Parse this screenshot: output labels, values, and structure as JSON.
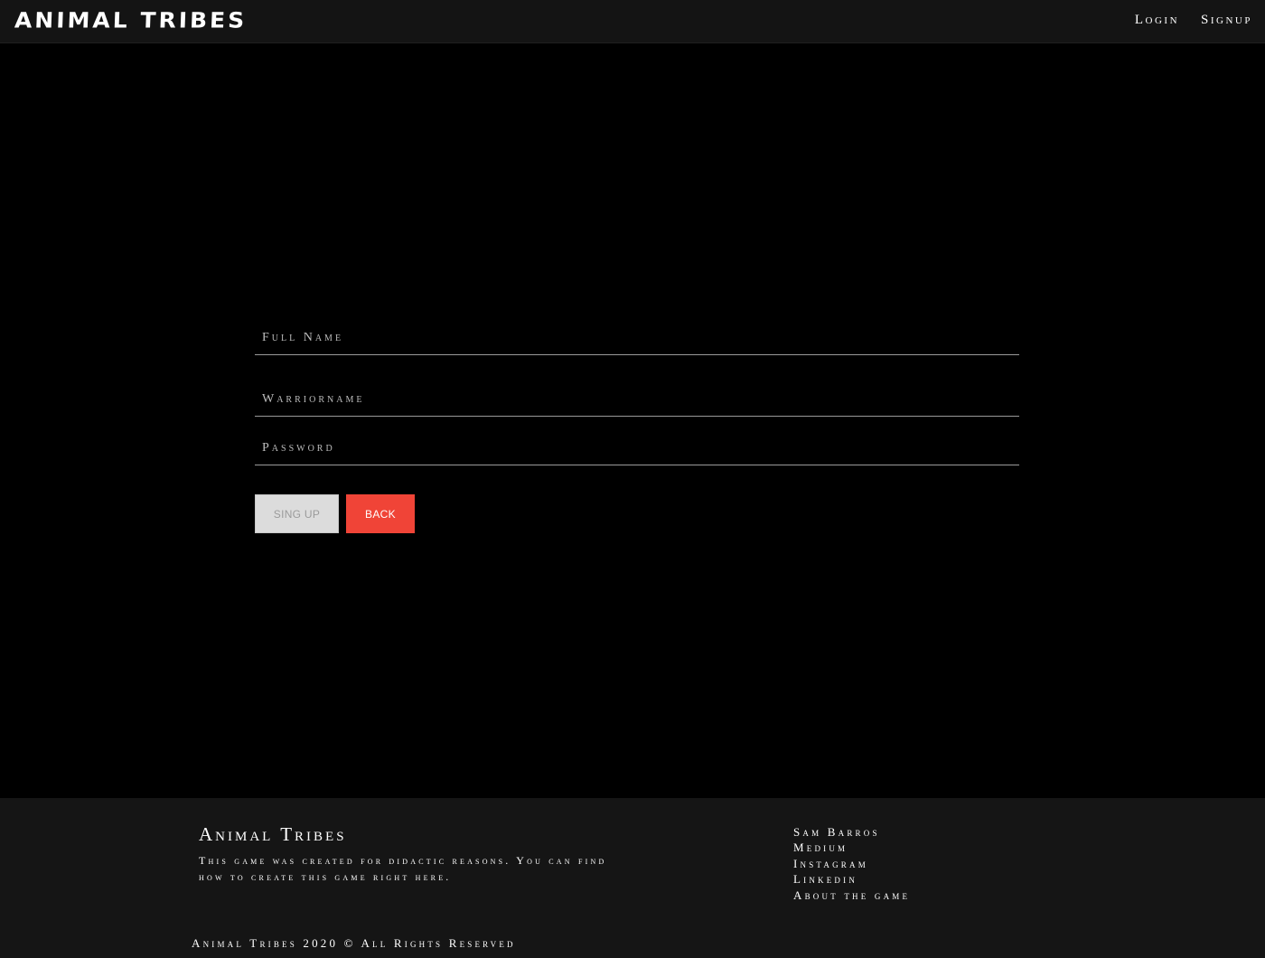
{
  "header": {
    "brand": "ANIMAL TRIBES",
    "nav": [
      {
        "label": "Login"
      },
      {
        "label": "Signup"
      }
    ]
  },
  "form": {
    "full_name_placeholder": "Full Name",
    "warriorname_placeholder": "Warriorname",
    "password_placeholder": "Password",
    "signup_label": "SING UP",
    "back_label": "BACK"
  },
  "footer": {
    "title": "Animal Tribes",
    "description": "This game was created for didactic reasons. You can find how to create this game right here.",
    "links": [
      {
        "label": "Sam Barros"
      },
      {
        "label": "Medium"
      },
      {
        "label": "Instagram"
      },
      {
        "label": "Linkedin"
      },
      {
        "label": "About the game"
      }
    ],
    "copyright": "Animal Tribes 2020 © All Rights Reserved"
  },
  "colors": {
    "background": "#000000",
    "bars": "#151515",
    "back_button": "#f04437",
    "signup_button": "#dcdcdc"
  }
}
